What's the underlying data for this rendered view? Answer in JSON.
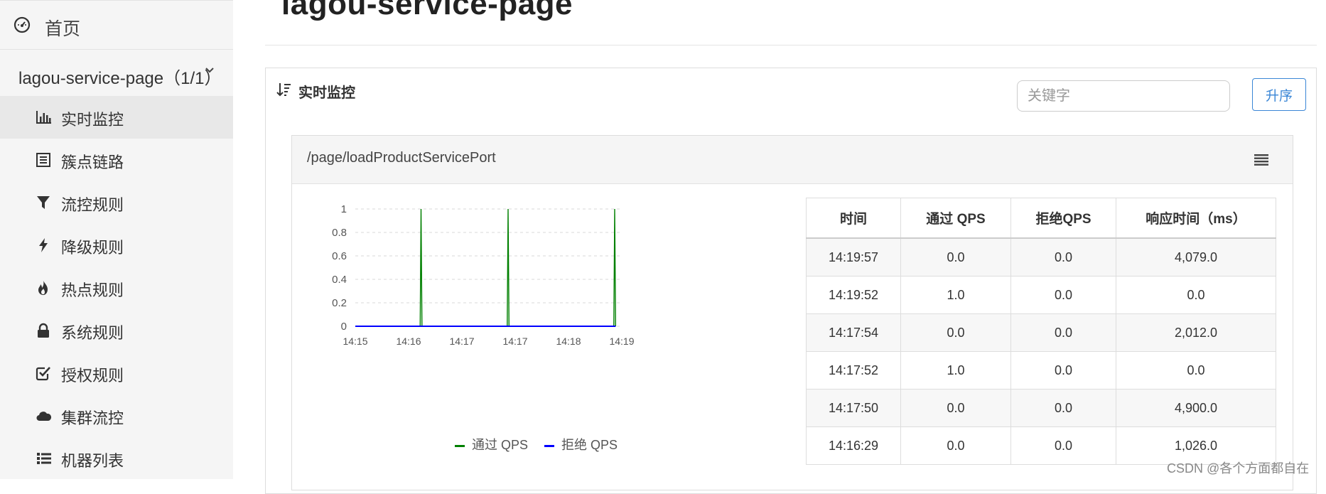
{
  "sidebar": {
    "home": {
      "label": "首页",
      "icon": "dashboard-icon"
    },
    "app": {
      "label": "lagou-service-page（1/1）",
      "icon": "chevron-down-icon"
    },
    "items": [
      {
        "label": "实时监控",
        "icon": "bar-chart-icon",
        "active": true
      },
      {
        "label": "簇点链路",
        "icon": "list-icon"
      },
      {
        "label": "流控规则",
        "icon": "filter-icon"
      },
      {
        "label": "降级规则",
        "icon": "bolt-icon"
      },
      {
        "label": "热点规则",
        "icon": "fire-icon"
      },
      {
        "label": "系统规则",
        "icon": "lock-icon"
      },
      {
        "label": "授权规则",
        "icon": "check-square-icon"
      },
      {
        "label": "集群流控",
        "icon": "cloud-icon"
      },
      {
        "label": "机器列表",
        "icon": "list-ul-icon"
      }
    ]
  },
  "page": {
    "title": "lagou-service-page"
  },
  "panel": {
    "title": "实时监控",
    "search_placeholder": "关键字",
    "sort_label": "升序"
  },
  "resource": {
    "name": "/page/loadProductServicePort",
    "table": {
      "headers": [
        "时间",
        "通过 QPS",
        "拒绝QPS",
        "响应时间（ms）"
      ],
      "rows": [
        [
          "14:19:57",
          "0.0",
          "0.0",
          "4,079.0"
        ],
        [
          "14:19:52",
          "1.0",
          "0.0",
          "0.0"
        ],
        [
          "14:17:54",
          "0.0",
          "0.0",
          "2,012.0"
        ],
        [
          "14:17:52",
          "1.0",
          "0.0",
          "0.0"
        ],
        [
          "14:17:50",
          "0.0",
          "0.0",
          "4,900.0"
        ],
        [
          "14:16:29",
          "0.0",
          "0.0",
          "1,026.0"
        ]
      ]
    }
  },
  "chart_data": {
    "type": "line",
    "x_ticks": [
      "14:15",
      "14:16",
      "14:17",
      "14:17",
      "14:18",
      "14:19"
    ],
    "y_ticks": [
      "1",
      "0.8",
      "0.6",
      "0.4",
      "0.2",
      "0"
    ],
    "ylim": [
      0,
      1
    ],
    "grid": true,
    "legend_position": "bottom",
    "series": [
      {
        "name": "通过 QPS",
        "color": "#008000",
        "points": [
          [
            "14:15:00",
            0
          ],
          [
            "14:16:13",
            0
          ],
          [
            "14:16:14",
            1
          ],
          [
            "14:16:15",
            0
          ],
          [
            "14:17:51",
            0
          ],
          [
            "14:17:52",
            1
          ],
          [
            "14:17:53",
            0
          ],
          [
            "14:19:51",
            0
          ],
          [
            "14:19:52",
            1
          ],
          [
            "14:19:53",
            0
          ]
        ]
      },
      {
        "name": "拒绝 QPS",
        "color": "#0000ff",
        "points": [
          [
            "14:15:00",
            0
          ],
          [
            "14:19:53",
            0
          ]
        ]
      }
    ]
  },
  "watermark": "CSDN @各个方面都自在"
}
